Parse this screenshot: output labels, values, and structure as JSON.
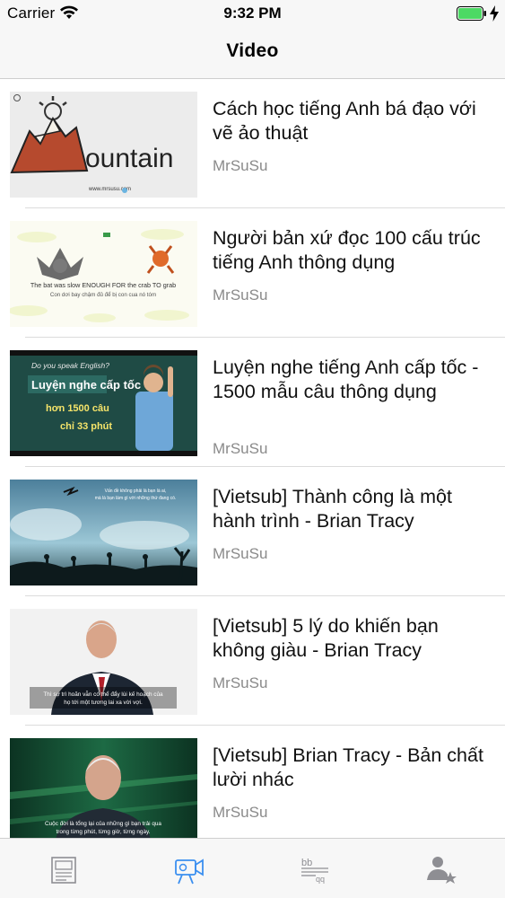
{
  "status_bar": {
    "carrier": "Carrier",
    "time": "9:32 PM"
  },
  "nav": {
    "title": "Video"
  },
  "videos": [
    {
      "title": "Cách học tiếng Anh bá đạo với vẽ ảo thuật",
      "channel": "MrSuSu",
      "thumb_text": [
        "ountain",
        "www.mrsusu.com"
      ]
    },
    {
      "title": "Người bản xứ đọc 100 cấu trúc tiếng Anh thông dụng",
      "channel": "MrSuSu",
      "thumb_text": [
        "The bat was slow ENOUGH FOR the crab TO grab",
        "Con dơi bay chậm đủ để bị con cua nó tóm"
      ]
    },
    {
      "title": "Luyện nghe tiếng Anh cấp tốc - 1500 mẫu câu thông dụng",
      "channel": "MrSuSu",
      "thumb_text": [
        "Do you speak English?",
        "Luyện nghe cấp tốc",
        "hơn 1500 câu",
        "chỉ 33 phút"
      ]
    },
    {
      "title": "[Vietsub] Thành công là một hành trình - Brian Tracy",
      "channel": "MrSuSu",
      "thumb_text": [
        "Vấn đề không phải là bạn là ai,",
        "mà là bạn làm gì với những thứ đang có."
      ]
    },
    {
      "title": "[Vietsub] 5 lý do khiến bạn không giàu - Brian Tracy",
      "channel": "MrSuSu",
      "thumb_text": [
        "Thì sự trì hoãn vẫn có thể đẩy lùi kế hoạch của",
        "họ tới một tương lai xa vời vợi."
      ]
    },
    {
      "title": "[Vietsub] Brian Tracy - Bản chất lười nhác",
      "channel": "MrSuSu",
      "thumb_text": [
        "Cuộc đời là tổng lại của những gì bạn trải qua",
        "trong từng phút, từng giờ, từng ngày."
      ]
    }
  ],
  "tab_bar": {
    "tabs": [
      {
        "icon": "news-icon",
        "selected": false
      },
      {
        "icon": "video-camera-icon",
        "selected": true
      },
      {
        "icon": "dictionary-icon",
        "selected": false
      },
      {
        "icon": "profile-favorite-icon",
        "selected": false
      }
    ]
  },
  "colors": {
    "accent": "#3b8ff0",
    "inactive_icon": "#8e8e93",
    "channel_text": "#8a8a8a",
    "battery_fill": "#4cd964"
  }
}
